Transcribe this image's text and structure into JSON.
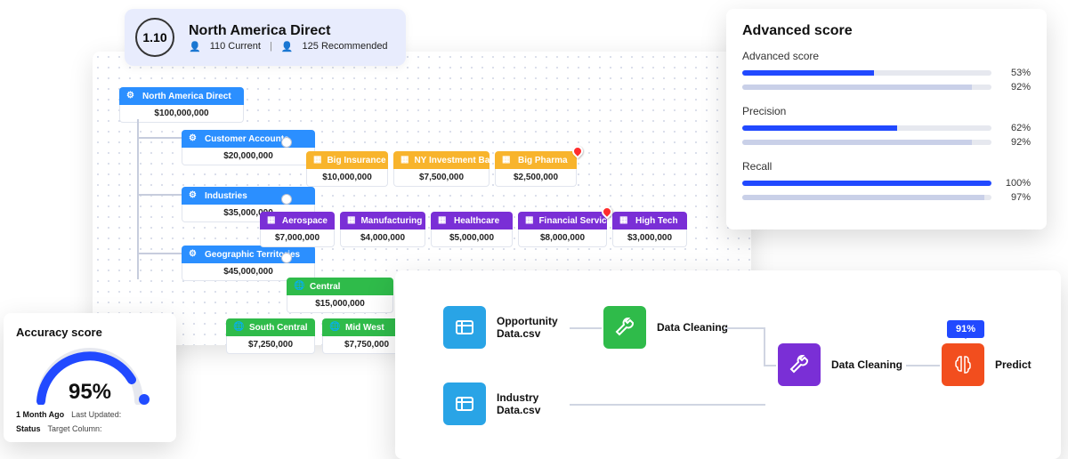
{
  "header": {
    "badge": "1.10",
    "title": "North America Direct",
    "current_count": "110 Current",
    "recommended_count": "125 Recommended"
  },
  "tree": {
    "root": {
      "label": "North America Direct",
      "value": "$100,000,000"
    },
    "level1": [
      {
        "label": "Customer Accounts",
        "value": "$20,000,000"
      },
      {
        "label": "Industries",
        "value": "$35,000,000"
      },
      {
        "label": "Geographic Territories",
        "value": "$45,000,000"
      }
    ],
    "customer_accounts_children": [
      {
        "label": "Big Insurance",
        "value": "$10,000,000"
      },
      {
        "label": "NY Investment Banks",
        "value": "$7,500,000"
      },
      {
        "label": "Big Pharma",
        "value": "$2,500,000"
      }
    ],
    "industries_children": [
      {
        "label": "Aerospace",
        "value": "$7,000,000"
      },
      {
        "label": "Manufacturing",
        "value": "$4,000,000"
      },
      {
        "label": "Healthcare",
        "value": "$5,000,000"
      },
      {
        "label": "Financial Services",
        "value": "$8,000,000"
      },
      {
        "label": "High Tech",
        "value": "$3,000,000"
      }
    ],
    "geo_child": {
      "label": "Central",
      "value": "$15,000,000"
    },
    "geo_grandchildren": [
      {
        "label": "South Central",
        "value": "$7,250,000"
      },
      {
        "label": "Mid West",
        "value": "$7,750,000"
      }
    ]
  },
  "accuracy": {
    "title": "Accuracy score",
    "percent": "95%",
    "row1_k": "1 Month Ago",
    "row1_v": "Last Updated:",
    "row2_k": "Status",
    "row2_v": "Target Column:"
  },
  "advanced": {
    "title": "Advanced score",
    "metrics": [
      {
        "label": "Advanced score",
        "primary": "53%",
        "primary_w": "53%",
        "secondary": "92%",
        "secondary_w": "92%"
      },
      {
        "label": "Precision",
        "primary": "62%",
        "primary_w": "62%",
        "secondary": "92%",
        "secondary_w": "92%"
      },
      {
        "label": "Recall",
        "primary": "100%",
        "primary_w": "100%",
        "secondary": "97%",
        "secondary_w": "97%"
      }
    ]
  },
  "pipeline": {
    "nodes": {
      "csv1": "Opportunity Data.csv",
      "csv2": "Industry Data.csv",
      "clean1": "Data Cleaning",
      "clean2": "Data Cleaning",
      "predict": "Predict"
    },
    "badge": "91%"
  }
}
